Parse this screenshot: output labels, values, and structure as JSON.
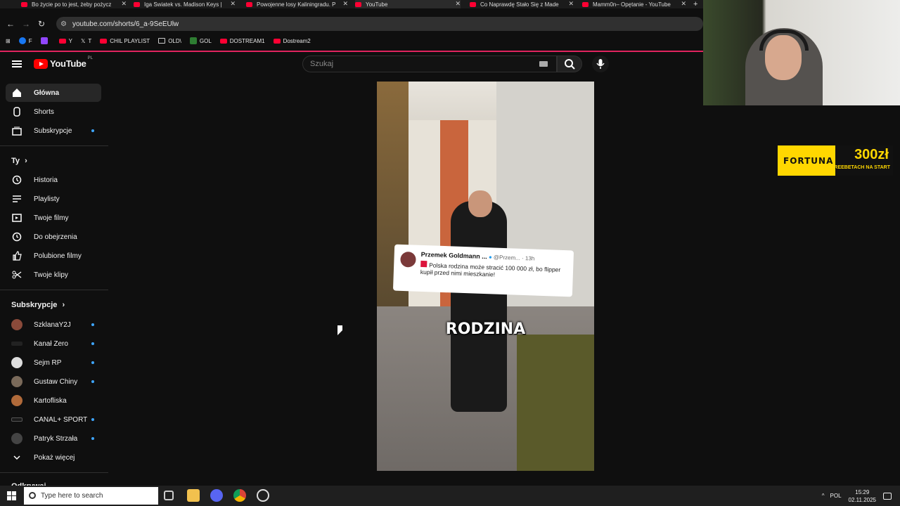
{
  "browser": {
    "tabs": [
      {
        "title": "Bo życie po to jest, żeby pożycz"
      },
      {
        "title": "Iga Swiatek vs. Madison Keys |"
      },
      {
        "title": "Powojenne losy Kaliningradu. P"
      },
      {
        "title": "YouTube"
      },
      {
        "title": "Co Naprawdę Stało Się z Made"
      },
      {
        "title": "Mamm0n– Opętanie - YouTube"
      }
    ],
    "url": "youtube.com/shorts/6_a-9SeEUlw",
    "bookmarks": [
      "F",
      "",
      "Y",
      "T",
      "CHIL PLAYLIST",
      "OLD\\",
      "GOL",
      "DOSTREAM1",
      "Dostream2"
    ]
  },
  "youtube": {
    "logo_text": "YouTube",
    "country": "PL",
    "search_placeholder": "Szukaj",
    "sidebar": {
      "main": [
        "Główna",
        "Shorts",
        "Subskrypcje"
      ],
      "you_header": "Ty",
      "you": [
        "Historia",
        "Playlisty",
        "Twoje filmy",
        "Do obejrzenia",
        "Polubione filmy",
        "Twoje klipy"
      ],
      "subs_header": "Subskrypcje",
      "subs": [
        "SzklanaY2J",
        "Kanał Zero",
        "Sejm RP",
        "Gustaw Chiny",
        "Kartofliska",
        "CANAL+ SPORT",
        "Patryk Strzała"
      ],
      "show_more": "Pokaż więcej",
      "explore_header": "Odkrywaj"
    },
    "short": {
      "tweet_name": "Przemek Goldmann ...",
      "tweet_handle": "@Przem... · 13h",
      "tweet_body": "Polska rodzina może stracić 100 000 zł, bo flipper kupił przed nimi mieszkanie!",
      "caption": "RODZINA"
    }
  },
  "ad": {
    "brand": "FORTUNA",
    "amount": "300zł",
    "sub": "WE FREEBETACH NA START"
  },
  "taskbar": {
    "search_placeholder": "Type here to search",
    "lang": "POL",
    "time": "15:29",
    "date": "02.11.2025"
  }
}
